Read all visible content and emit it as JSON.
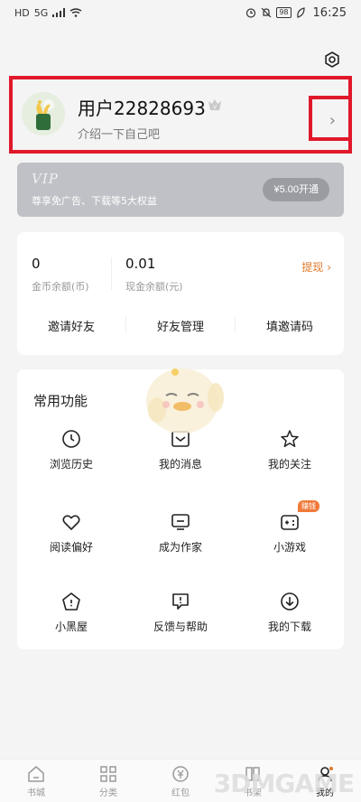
{
  "status_bar": {
    "hd": "HD",
    "net": "5G",
    "battery": "98",
    "time": "16:25"
  },
  "profile": {
    "username": "用户22828693",
    "bio": "介绍一下自己吧"
  },
  "vip": {
    "title": "VIP",
    "desc": "尊享免广告、下载等5大权益",
    "button": "¥5.00开通"
  },
  "wallet": {
    "coins_value": "0",
    "coins_label": "金币余额(币)",
    "cash_value": "0.01",
    "cash_label": "现金余额(元)",
    "withdraw": "提现",
    "actions": [
      "邀请好友",
      "好友管理",
      "填邀请码"
    ]
  },
  "functions": {
    "title": "常用功能",
    "items": [
      {
        "label": "浏览历史",
        "icon": "clock-icon"
      },
      {
        "label": "我的消息",
        "icon": "message-icon"
      },
      {
        "label": "我的关注",
        "icon": "star-icon"
      },
      {
        "label": "阅读偏好",
        "icon": "heart-icon"
      },
      {
        "label": "成为作家",
        "icon": "writer-icon"
      },
      {
        "label": "小游戏",
        "icon": "gamepad-icon",
        "badge": "赚钱"
      },
      {
        "label": "小黑屋",
        "icon": "house-icon"
      },
      {
        "label": "反馈与帮助",
        "icon": "feedback-icon"
      },
      {
        "label": "我的下载",
        "icon": "download-icon"
      }
    ]
  },
  "bottom_nav": [
    {
      "label": "书城",
      "icon": "home-icon"
    },
    {
      "label": "分类",
      "icon": "grid-icon"
    },
    {
      "label": "红包",
      "icon": "redpacket-icon"
    },
    {
      "label": "书架",
      "icon": "bookshelf-icon"
    },
    {
      "label": "我的",
      "icon": "profile-icon"
    }
  ],
  "watermark": "3DMGAME",
  "colors": {
    "accent": "#e07a2d",
    "highlight": "#e0182a",
    "vip_bg": "#bfc1c6"
  }
}
